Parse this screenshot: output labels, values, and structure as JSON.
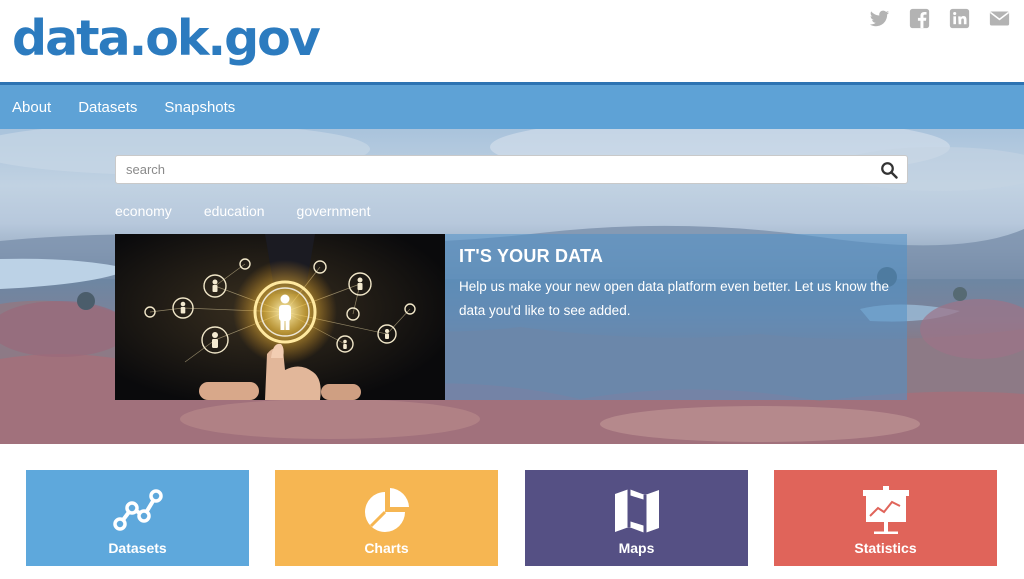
{
  "header": {
    "logo": "data.ok.gov",
    "social": [
      "twitter-icon",
      "facebook-icon",
      "linkedin-icon",
      "email-icon"
    ]
  },
  "nav": {
    "items": [
      "About",
      "Datasets",
      "Snapshots"
    ]
  },
  "search": {
    "placeholder": "search",
    "value": ""
  },
  "tags": [
    "economy",
    "education",
    "government"
  ],
  "feature": {
    "title": "IT'S YOUR DATA",
    "text": "Help us make your new open data platform even better. Let us know the data you'd like to see added."
  },
  "tiles": [
    {
      "label": "Datasets",
      "color": "#5ea8dc",
      "icon": "line-graph-icon"
    },
    {
      "label": "Charts",
      "color": "#f6b652",
      "icon": "pie-chart-icon"
    },
    {
      "label": "Maps",
      "color": "#555084",
      "icon": "map-icon"
    },
    {
      "label": "Statistics",
      "color": "#e0645a",
      "icon": "presentation-chart-icon"
    }
  ],
  "colors": {
    "brand": "#2c7bbf",
    "nav": "#5ea2d6",
    "nav_border": "#2d73b2",
    "social_icon": "#b3b3b3"
  }
}
